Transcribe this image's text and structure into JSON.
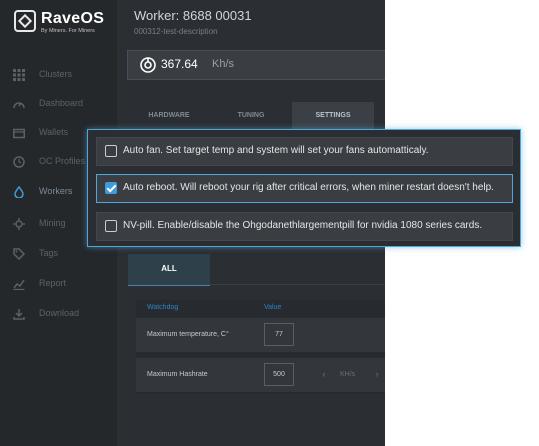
{
  "brand": {
    "name": "RaveOS",
    "tagline": "By Miners. For Miners"
  },
  "sidebar": {
    "items": [
      {
        "label": "Clusters",
        "icon": "grid-icon"
      },
      {
        "label": "Dashboard",
        "icon": "gauge-icon"
      },
      {
        "label": "Wallets",
        "icon": "wallet-icon"
      },
      {
        "label": "OC Profiles",
        "icon": "clock-icon"
      },
      {
        "label": "Workers",
        "icon": "drop-icon",
        "active": true
      },
      {
        "label": "Mining",
        "icon": "gear-icon"
      },
      {
        "label": "Tags",
        "icon": "tag-icon"
      },
      {
        "label": "Report",
        "icon": "chart-icon"
      },
      {
        "label": "Download",
        "icon": "download-icon"
      }
    ]
  },
  "header": {
    "title": "Worker: 8688 00031",
    "description": "000312-test-description",
    "hashrate": {
      "value": "367.64",
      "unit": "Kh/s"
    }
  },
  "tabs": [
    {
      "label": "HARDWARE"
    },
    {
      "label": "TUNING"
    },
    {
      "label": "SETTINGS",
      "active": true
    }
  ],
  "settings_dropdown": {
    "options": [
      {
        "label": "Auto fan. Set target temp and system will set your fans automatticaly.",
        "checked": false
      },
      {
        "label": "Auto reboot. Will reboot your rig after critical errors, when miner restart doesn't help.",
        "checked": true
      },
      {
        "label": "NV-pill. Enable/disable the Ohgodanethlargementpill for nvidia 1080 series cards.",
        "checked": false
      }
    ]
  },
  "subtab": {
    "label": "ALL"
  },
  "watchdog_table": {
    "headers": [
      "Watchdog",
      "Value"
    ],
    "rows": [
      {
        "label": "Maximum temperature, C°",
        "value": "77"
      },
      {
        "label": "Maximum Hashrate",
        "value": "500",
        "unit": "KH/s",
        "prev": "‹",
        "next": "›"
      }
    ]
  },
  "colors": {
    "accent": "#4fa7d8",
    "sidebar_bg": "#25282b",
    "content_bg": "#2b2e32"
  }
}
